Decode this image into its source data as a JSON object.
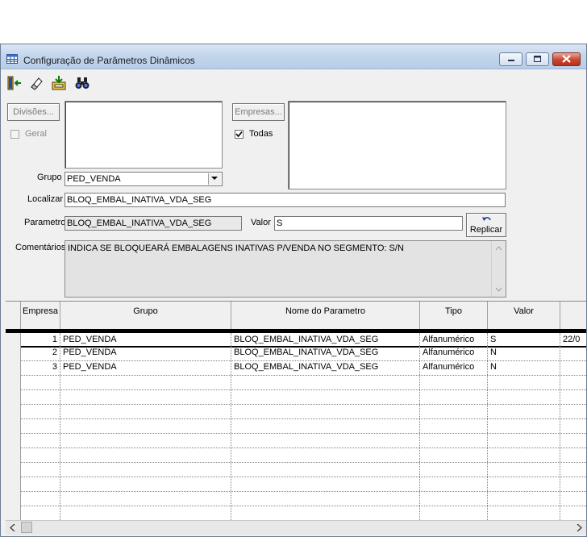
{
  "window": {
    "title": "Configuração de Parâmetros Dinâmicos",
    "controls": [
      "minimize-icon",
      "maximize-icon",
      "close-icon"
    ]
  },
  "toolbar": {
    "buttons": [
      {
        "icon": "exit-door-icon"
      },
      {
        "icon": "eraser-icon"
      },
      {
        "icon": "save-disk-icon"
      },
      {
        "icon": "binoculars-search-icon"
      }
    ]
  },
  "form": {
    "divisoes_label": "Divisões...",
    "geral_label": "Geral",
    "geral_checked": false,
    "empresas_label": "Empresas...",
    "todas_label": "Todas",
    "todas_checked": true,
    "grupo_label": "Grupo",
    "grupo_value": "PED_VENDA",
    "localizar_label": "Localizar",
    "localizar_value": "BLOQ_EMBAL_INATIVA_VDA_SEG",
    "parametro_label": "Parametro",
    "parametro_value": "BLOQ_EMBAL_INATIVA_VDA_SEG",
    "valor_label": "Valor",
    "valor_value": "S",
    "replicar_label": "Replicar",
    "comentarios_label": "Comentários",
    "comentarios_value": "INDICA SE BLOQUEARÁ EMBALAGENS INATIVAS P/VENDA NO SEGMENTO: S/N"
  },
  "grid": {
    "columns": [
      "Empresa",
      "Grupo",
      "Nome do Parametro",
      "Tipo",
      "Valor",
      ""
    ],
    "rows": [
      {
        "empresa": "1",
        "grupo": "PED_VENDA",
        "nome": "BLOQ_EMBAL_INATIVA_VDA_SEG",
        "tipo": "Alfanumérico",
        "valor": "S",
        "extra": "22/0"
      },
      {
        "empresa": "2",
        "grupo": "PED_VENDA",
        "nome": "BLOQ_EMBAL_INATIVA_VDA_SEG",
        "tipo": "Alfanumérico",
        "valor": "N",
        "extra": ""
      },
      {
        "empresa": "3",
        "grupo": "PED_VENDA",
        "nome": "BLOQ_EMBAL_INATIVA_VDA_SEG",
        "tipo": "Alfanumérico",
        "valor": "N",
        "extra": ""
      }
    ],
    "selected_row": 0
  },
  "colors": {
    "title_bar": "#c2d5ec",
    "window_bg": "#f0f0f0",
    "close_button": "#c8452f",
    "readonly_field": "#e9e9e9"
  }
}
